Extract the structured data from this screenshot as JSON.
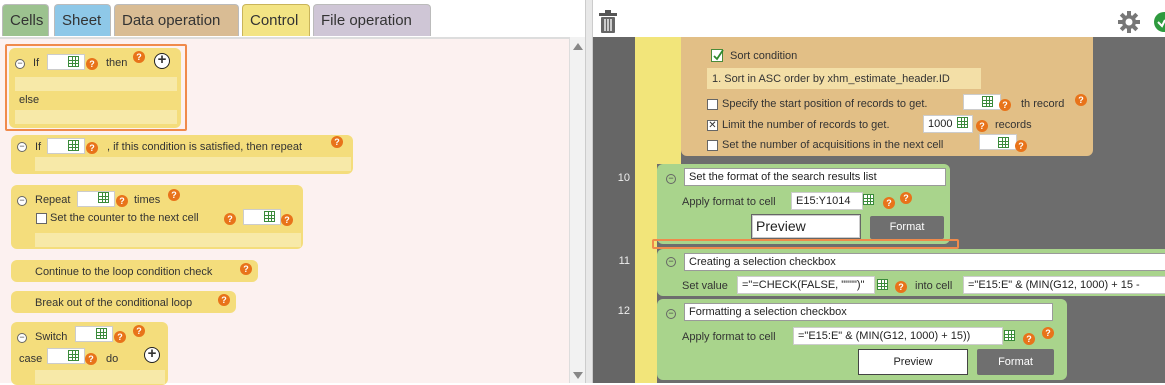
{
  "tabs": [
    "Cells",
    "Sheet",
    "Data operation",
    "Control",
    "File operation"
  ],
  "palette": {
    "if_block": {
      "if": "If",
      "then": "then",
      "else": "else"
    },
    "if_repeat": {
      "if": "If",
      "suffix": ", if this condition is satisfied, then repeat"
    },
    "repeat": {
      "repeat": "Repeat",
      "times": "times",
      "counter_label": "Set the counter to the next cell"
    },
    "continue_label": "Continue to the loop condition check",
    "break_label": "Break out of the conditional loop",
    "switch": {
      "switch": "Switch",
      "case": "case",
      "do": "do"
    }
  },
  "editor": {
    "sort": {
      "title": "Sort condition",
      "item": "1. Sort in ASC order by xhm_estimate_header.ID",
      "start_label": "Specify the start position of records to get.",
      "start_suffix": "th record",
      "limit_label": "Limit the number of records to get.",
      "limit_value": "1000",
      "limit_suffix": "records",
      "next_label": "Set the number of acquisitions in the next cell"
    },
    "line10": {
      "num": "10",
      "title": "Set the format of the search results list",
      "apply_label": "Apply format to cell",
      "cell_value": "E15:Y1014",
      "preview": "Preview",
      "format": "Format"
    },
    "line11": {
      "num": "11",
      "title": "Creating a selection checkbox",
      "set_label": "Set value",
      "value": "=\"=CHECK(FALSE, \"\"\"\")\"",
      "into_label": "into cell",
      "cell_value": "=\"E15:E\" & (MIN(G12, 1000) + 15 -"
    },
    "line12": {
      "num": "12",
      "title": "Formatting a selection checkbox",
      "apply_label": "Apply format to cell",
      "cell_value": "=\"E15:E\" & (MIN(G12, 1000) + 15))",
      "preview": "Preview",
      "format": "Format"
    }
  },
  "colors": {
    "accent": "#f08a4b",
    "block_yellow": "#f4dd7c",
    "block_green": "#a9d48c",
    "block_tan": "#e2bf86"
  }
}
